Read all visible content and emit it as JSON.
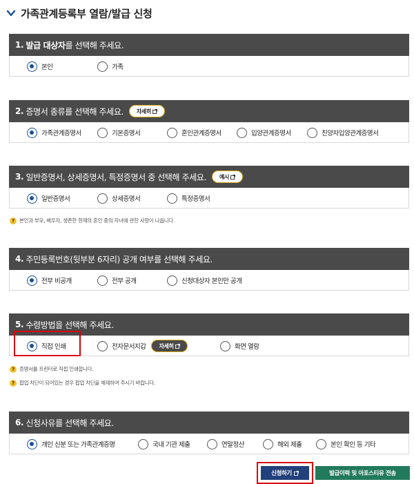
{
  "page": {
    "title": "가족관계등록부 열람/발급 신청"
  },
  "sections": [
    {
      "num": "1.",
      "title_bold": "발급 대상자",
      "title_rest": "를 선택해 주세요.",
      "options": [
        "본인",
        "가족"
      ]
    },
    {
      "num": "2.",
      "title_bold": "",
      "title_rest": "증명서 종류를 선택해 주세요.",
      "pill": "자세히",
      "options": [
        "가족관계증명서",
        "기본증명서",
        "혼인관계증명서",
        "입양관계증명서",
        "친양자입양관계증명서"
      ]
    },
    {
      "num": "3.",
      "title_bold": "",
      "title_rest": "일반증명서, 상세증명서, 특정증명서 중 선택해 주세요.",
      "pill": "예시",
      "options": [
        "일반증명서",
        "상세증명서",
        "특정증명서"
      ]
    },
    {
      "num": "4.",
      "title_bold": "",
      "title_rest": "주민등록번호(뒷부분 6자리) 공개 여부를 선택해 주세요.",
      "options": [
        "전부 비공개",
        "전부 공개",
        "신청대상자 본인만 공개"
      ]
    },
    {
      "num": "5.",
      "title_bold": "",
      "title_rest": "수령방법을 선택해 주세요.",
      "pill": "자세히",
      "options": [
        "직접 인쇄",
        "전자문서지갑",
        "화면 열람"
      ]
    },
    {
      "num": "6.",
      "title_bold": "",
      "title_rest": "신청사유를 선택해 주세요.",
      "options": [
        "개인 신분 또는 가족관계증명",
        "국내 기관 제출",
        "연말정산",
        "해외 제출",
        "본인 확인 등 기타"
      ]
    }
  ],
  "notes": {
    "sec3": "본인과 부모, 배우자, 생존한 현재의 혼인 중의 자녀에 관한 사항이 나옵니다.",
    "sec5_1": "증명서를 프린터로 직접 인쇄합니다.",
    "sec5_2": "팝업 차단이 되어있는 경우 팝업 차단을 해제하여 주시기 바랍니다."
  },
  "actions": {
    "apply": "신청하기",
    "history": "발급이력 및 아포스티유 전송"
  },
  "colors": {
    "header_bg": "#4a4a4a",
    "radio_selected": "#1b4f98",
    "pill_border": "#d9a81b",
    "highlight": "#d90000",
    "btn_apply": "#22407b",
    "btn_history": "#227a5c"
  }
}
